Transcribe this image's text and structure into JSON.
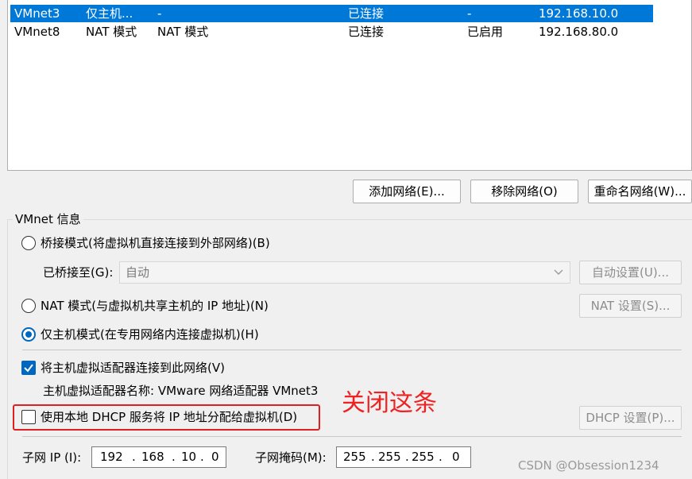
{
  "network_list": {
    "rows": [
      {
        "name": "VMnet3",
        "type": "仅主机...",
        "nat": "-",
        "host": "已连接",
        "dhcp": "-",
        "subnet": "192.168.10.0",
        "selected": true
      },
      {
        "name": "VMnet8",
        "type": "NAT 模式",
        "nat": "NAT 模式",
        "host": "已连接",
        "dhcp": "已启用",
        "subnet": "192.168.80.0",
        "selected": false
      }
    ]
  },
  "list_buttons": {
    "add": "添加网络(E)...",
    "remove": "移除网络(O)",
    "rename": "重命名网络(W)..."
  },
  "vmnet_info": {
    "legend": "VMnet 信息",
    "bridge_label": "桥接模式(将虚拟机直接连接到外部网络)(B)",
    "bridged_to_label": "已桥接至(G):",
    "bridged_to_value": "自动",
    "auto_settings": "自动设置(U)...",
    "nat_label": "NAT 模式(与虚拟机共享主机的 IP 地址)(N)",
    "nat_settings": "NAT 设置(S)...",
    "host_only_label": "仅主机模式(在专用网络内连接虚拟机)(H)",
    "connect_adapter_label": "将主机虚拟适配器连接到此网络(V)",
    "adapter_name_text": "主机虚拟适配器名称: VMware 网络适配器 VMnet3",
    "dhcp_label": "使用本地 DHCP 服务将 IP 地址分配给虚拟机(D)",
    "dhcp_settings": "DHCP 设置(P)...",
    "subnet_ip_label": "子网 IP (I):",
    "subnet_ip": [
      "192",
      "168",
      "10",
      "0"
    ],
    "subnet_mask_label": "子网掩码(M):",
    "subnet_mask": [
      "255",
      "255",
      "255",
      "0"
    ]
  },
  "annotation": "关闭这条",
  "watermark": "CSDN @Obsession1234",
  "state": {
    "mode": "host-only",
    "connect_adapter_checked": true,
    "dhcp_checked": false
  },
  "colors": {
    "selection": "#0078d7",
    "accent": "#0067c0",
    "annotation": "#ee2222"
  }
}
